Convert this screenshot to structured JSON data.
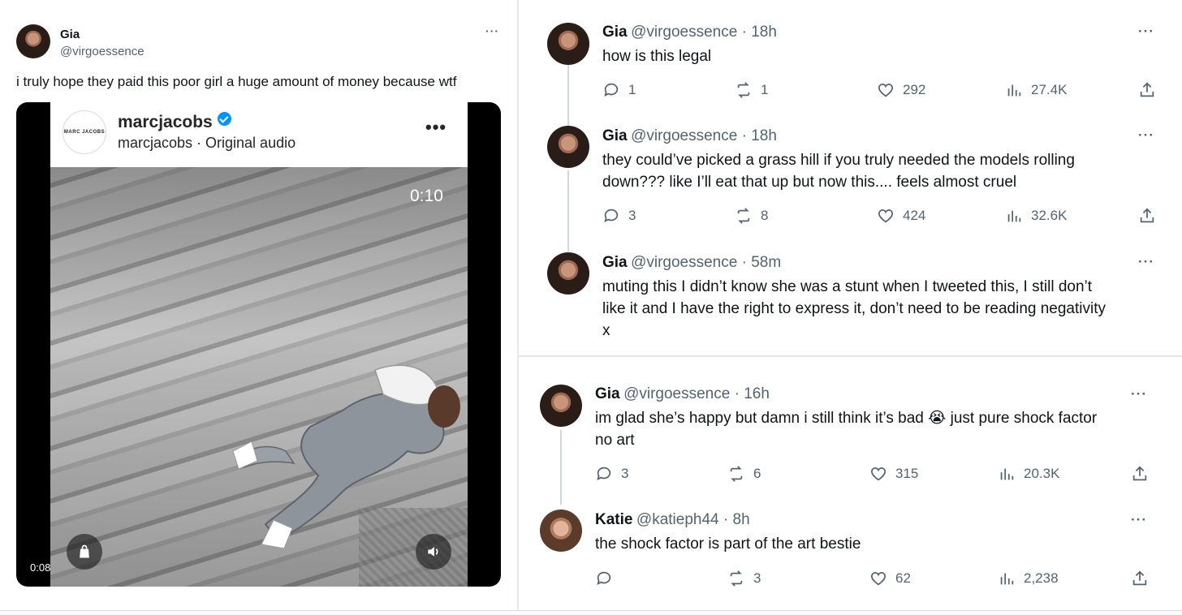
{
  "main_tweet": {
    "name": "Gia",
    "handle": "@virgoessence",
    "more": "···",
    "text": "i truly hope they paid this poor girl a huge amount of money because wtf",
    "media": {
      "account": "marcjacobs",
      "subtitle": "marcjacobs · Original audio",
      "logo_text": "MARC JACOBS",
      "more": "•••",
      "remaining_time": "0:10",
      "elapsed_time": "0:08",
      "icons": [
        "shopping-bag-icon",
        "sound-icon",
        "verified-icon"
      ]
    }
  },
  "thread": [
    {
      "name": "Gia",
      "handle": "@virgoessence · 18h",
      "text_lines": [
        "how is this legal"
      ],
      "replies": "1",
      "reposts": "1",
      "likes": "292",
      "views": "27.4K"
    },
    {
      "name": "Gia",
      "handle": "@virgoessence · 18h",
      "text_lines": [
        "they could’ve picked a grass hill if you truly needed the models rolling",
        "down??? like I’ll eat that up but now this.... feels almost cruel"
      ],
      "replies": "3",
      "reposts": "8",
      "likes": "424",
      "views": "32.6K"
    },
    {
      "name": "Gia",
      "handle": "@virgoessence · 58m",
      "text_lines": [
        "muting this I didn’t know she was a stunt when I tweeted this, I still don’t",
        "like it and I have the right to express it, don’t need to be reading negativity",
        "x"
      ]
    }
  ],
  "conversation": [
    {
      "name": "Gia",
      "handle": "@virgoessence · 16h",
      "text_lines": [
        "im glad she’s happy but damn i still think it’s bad 😭 just pure shock factor",
        "no art"
      ],
      "replies": "3",
      "reposts": "6",
      "likes": "315",
      "views": "20.3K"
    },
    {
      "name": "Katie",
      "handle": "@katieph44 · 8h",
      "text_lines": [
        "the shock factor is part of the art bestie"
      ],
      "replies": "",
      "reposts": "3",
      "likes": "62",
      "views": "2,238"
    }
  ],
  "colors": {
    "text": "#0f1419",
    "secondary": "#536471",
    "verified": "#0095f6",
    "thread_line": "#cfd9de"
  }
}
